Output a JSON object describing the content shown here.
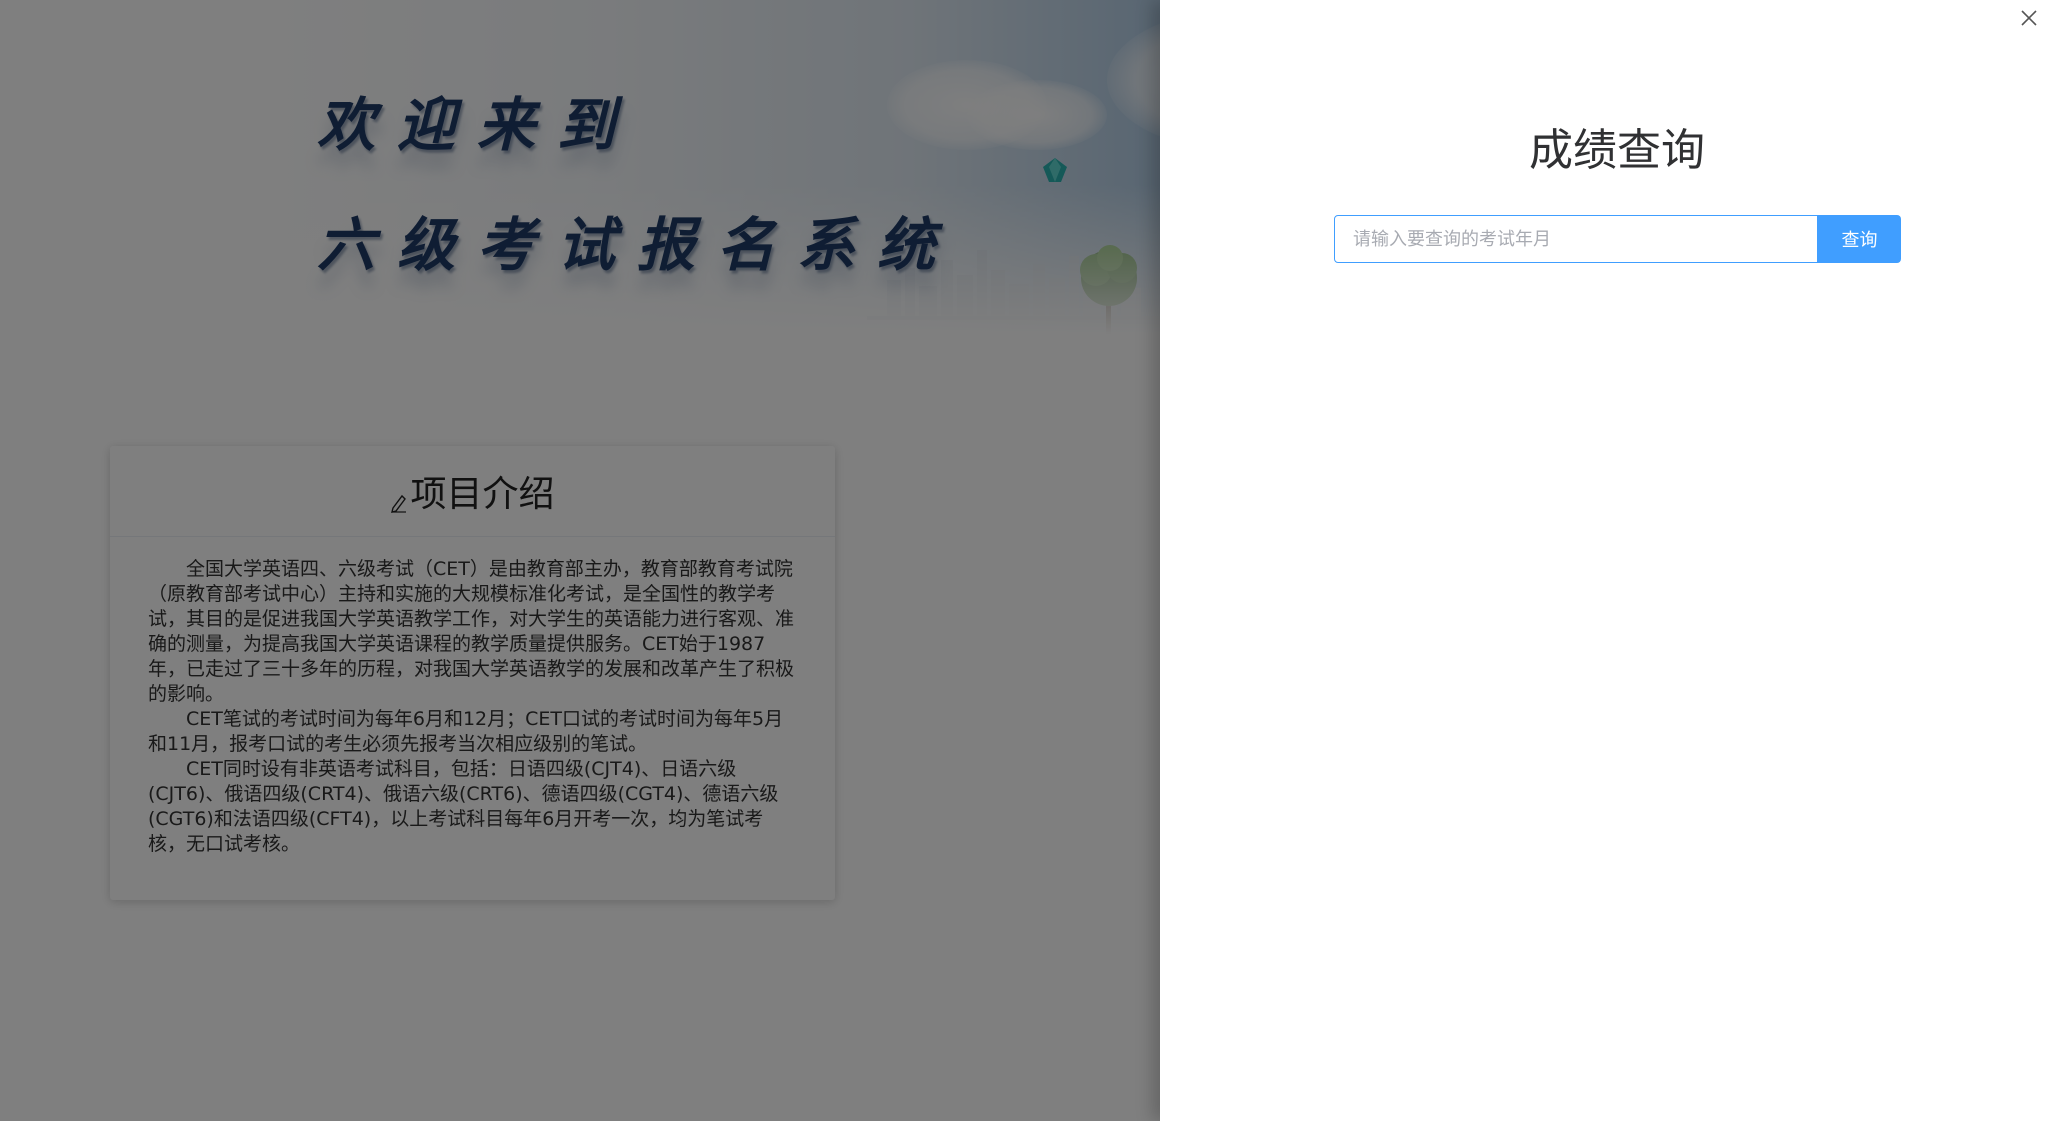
{
  "banner": {
    "line1": "欢迎来到",
    "line2": "六级考试报名系统"
  },
  "intro": {
    "title": "项目介绍",
    "paragraphs": [
      "全国大学英语四、六级考试（CET）是由教育部主办，教育部教育考试院（原教育部考试中心）主持和实施的大规模标准化考试，是全国性的教学考试，其目的是促进我国大学英语教学工作，对大学生的英语能力进行客观、准确的测量，为提高我国大学英语课程的教学质量提供服务。CET始于1987年，已走过了三十多年的历程，对我国大学英语教学的发展和改革产生了积极的影响。",
      "CET笔试的考试时间为每年6月和12月；CET口试的考试时间为每年5月和11月，报考口试的考生必须先报考当次相应级别的笔试。",
      "CET同时设有非英语考试科目，包括：日语四级(CJT4)、日语六级(CJT6)、俄语四级(CRT4)、俄语六级(CRT6)、德语四级(CGT4)、德语六级(CGT6)和法语四级(CFT4)，以上考试科目每年6月开考一次，均为笔试考核，无口试考核。"
    ]
  },
  "drawer": {
    "title": "成绩查询",
    "search": {
      "placeholder": "请输入要查询的考试年月",
      "value": ""
    },
    "search_button_label": "查询"
  },
  "colors": {
    "accent": "#409eff",
    "mask": "rgba(0,0,0,0.5)"
  },
  "icons": {
    "close": "close-icon",
    "pen": "pen-icon"
  }
}
